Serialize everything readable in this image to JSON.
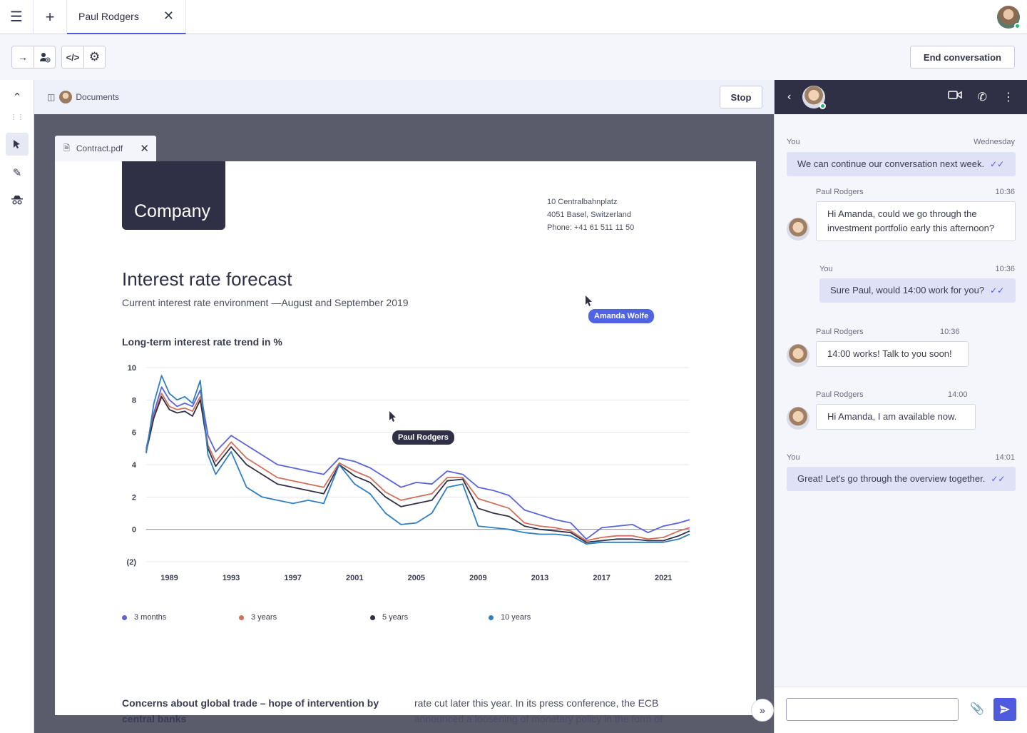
{
  "topbar": {
    "menu_icon": "hamburger-icon",
    "add_icon": "plus-icon",
    "tab_label": "Paul Rodgers",
    "tab_close_icon": "close-icon"
  },
  "toolbar": {
    "end_conversation": "End conversation",
    "icons": [
      "arrow-right-icon",
      "add-user-icon",
      "code-icon",
      "gear-icon"
    ]
  },
  "docbar": {
    "label": "Documents",
    "stop": "Stop"
  },
  "file_tab": {
    "name": "Contract.pdf"
  },
  "document": {
    "logo": "Company",
    "address": [
      "10 Centralbahnplatz",
      "4051 Basel, Switzerland",
      "Phone: +41 61 511 11 50"
    ],
    "title": "Interest rate forecast",
    "subtitle": "Current interest rate environment —August and September 2019",
    "chart_title": "Long-term interest rate trend in %",
    "body_left": "Concerns about global trade – hope of intervention by central banks",
    "body_right": "rate cut later this year. In its press conference, the ECB announced a loosening of monetary policy in the form of"
  },
  "cursors": {
    "amanda": "Amanda Wolfe",
    "paul": "Paul Rodgers"
  },
  "chart_data": {
    "type": "line",
    "title": "Long-term interest rate trend in %",
    "x_ticks": [
      "1989",
      "1993",
      "1997",
      "2001",
      "2005",
      "2009",
      "2013",
      "2017",
      "2021"
    ],
    "y_ticks": [
      "10",
      "8",
      "6",
      "4",
      "2",
      "0",
      "(2)"
    ],
    "ylim": [
      -2,
      10
    ],
    "xlim": [
      1987.5,
      2022.7
    ],
    "x": [
      1987.5,
      1988,
      1988.5,
      1989,
      1989.5,
      1990,
      1990.5,
      1991,
      1991.5,
      1992,
      1993,
      1994,
      1995,
      1996,
      1997,
      1998,
      1999,
      2000,
      2001,
      2002,
      2003,
      2004,
      2005,
      2006,
      2007,
      2008,
      2009,
      2010,
      2011,
      2012,
      2013,
      2014,
      2015,
      2016,
      2017,
      2018,
      2019,
      2020,
      2021,
      2022,
      2022.7
    ],
    "series": [
      {
        "name": "3 months",
        "color": "#5a64d6",
        "values": [
          5.0,
          7.2,
          8.8,
          8.0,
          7.6,
          7.8,
          7.6,
          8.6,
          5.8,
          4.8,
          5.8,
          5.2,
          4.6,
          4.0,
          3.8,
          3.6,
          3.4,
          4.4,
          4.2,
          3.8,
          3.2,
          2.6,
          2.9,
          2.8,
          3.6,
          3.4,
          2.6,
          2.4,
          2.1,
          1.2,
          0.9,
          0.6,
          0.4,
          -0.6,
          0.1,
          0.2,
          0.3,
          -0.2,
          0.2,
          0.4,
          0.6
        ]
      },
      {
        "name": "3 years",
        "color": "#d0705a",
        "values": [
          4.9,
          7.0,
          8.4,
          7.6,
          7.4,
          7.5,
          7.3,
          8.2,
          5.2,
          4.2,
          5.4,
          4.4,
          3.8,
          3.2,
          3.0,
          2.8,
          2.6,
          4.1,
          3.6,
          3.2,
          2.3,
          1.8,
          2.0,
          2.2,
          3.2,
          3.2,
          1.9,
          1.6,
          1.3,
          0.4,
          0.2,
          0.1,
          -0.1,
          -0.7,
          -0.5,
          -0.4,
          -0.4,
          -0.6,
          -0.5,
          -0.1,
          0.1
        ]
      },
      {
        "name": "5 years",
        "color": "#2f3045",
        "values": [
          4.8,
          6.9,
          8.2,
          7.4,
          7.2,
          7.3,
          7.0,
          8.0,
          5.0,
          3.9,
          5.1,
          4.0,
          3.4,
          2.8,
          2.6,
          2.4,
          2.2,
          4.0,
          3.3,
          2.9,
          2.0,
          1.4,
          1.6,
          1.8,
          3.0,
          3.1,
          1.3,
          1.0,
          0.8,
          0.2,
          0.0,
          -0.1,
          -0.2,
          -0.8,
          -0.7,
          -0.6,
          -0.6,
          -0.7,
          -0.7,
          -0.4,
          -0.1
        ]
      },
      {
        "name": "10 years",
        "color": "#2f7fc0",
        "values": [
          4.7,
          7.8,
          9.5,
          8.4,
          8.0,
          8.2,
          7.8,
          9.2,
          4.6,
          3.4,
          4.8,
          2.6,
          2.0,
          1.8,
          1.6,
          1.8,
          1.6,
          4.0,
          2.8,
          2.2,
          1.0,
          0.3,
          0.4,
          1.0,
          2.6,
          2.8,
          0.2,
          0.1,
          0.0,
          -0.2,
          -0.3,
          -0.3,
          -0.4,
          -0.9,
          -0.8,
          -0.8,
          -0.8,
          -0.8,
          -0.8,
          -0.6,
          -0.3
        ]
      }
    ]
  },
  "chat": {
    "header_icons": [
      "back-icon",
      "video-icon",
      "phone-icon",
      "more-icon"
    ],
    "messages": [
      {
        "sender": "You",
        "time": "Wednesday",
        "text": "We can continue our conversation next week."
      },
      {
        "sender": "Paul Rodgers",
        "time": "10:36",
        "text": "Hi Amanda, could we go through the investment portfolio early this afternoon?"
      },
      {
        "sender": "You",
        "time": "10:36",
        "text": "Sure Paul, would 14:00 work for you?"
      },
      {
        "sender": "Paul Rodgers",
        "time": "10:36",
        "text": "14:00 works! Talk to you soon!"
      },
      {
        "sender": "Paul Rodgers",
        "time": "14:00",
        "text": "Hi Amanda, I am available now."
      },
      {
        "sender": "You",
        "time": "14:01",
        "text": "Great! Let's go through the overview together."
      }
    ],
    "input_value": ""
  }
}
